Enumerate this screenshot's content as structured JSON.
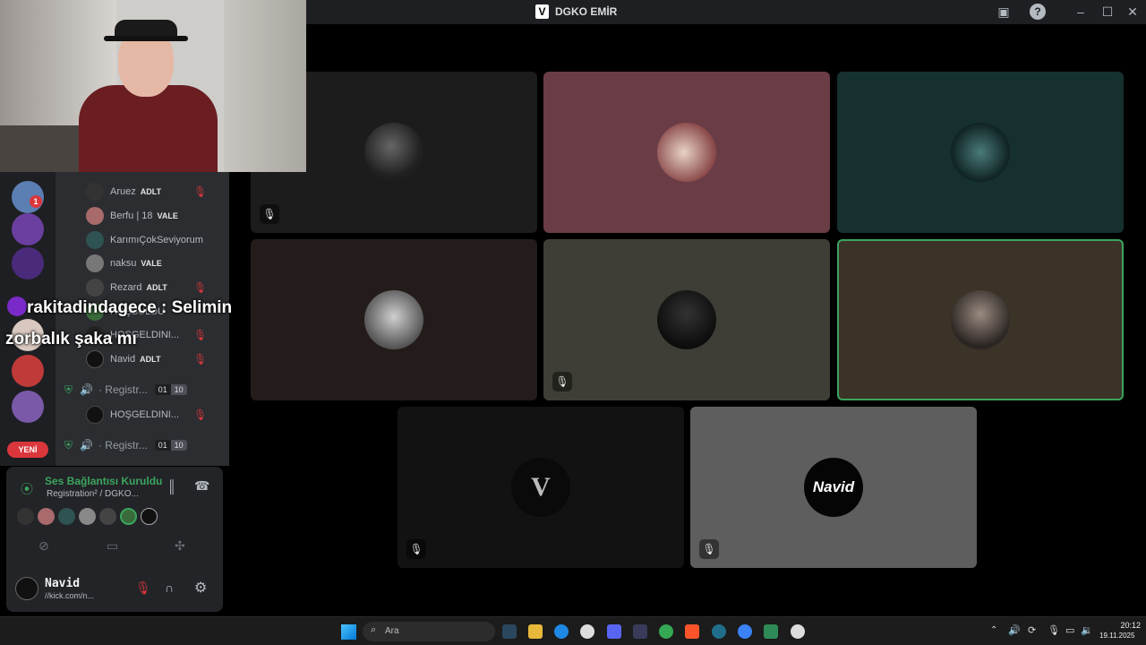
{
  "window": {
    "title": "DGKO EMİR",
    "logo_letter": "V"
  },
  "members": [
    {
      "name": "Aruez",
      "tag": "ADLT"
    },
    {
      "name": "Berfu | 18",
      "tag": "VALE"
    },
    {
      "name": "KarımıÇokSeviyorum",
      "tag": ""
    },
    {
      "name": "naksu",
      "tag": "VALE"
    },
    {
      "name": "Rezard",
      "tag": "ADLT"
    },
    {
      "name": "HOŞBULDU",
      "tag": ""
    },
    {
      "name": "HOŞGELDINI...",
      "tag": ""
    },
    {
      "name": "Navid",
      "tag": "ADLT"
    }
  ],
  "channels": [
    {
      "label": "· Registr...",
      "count_a": "01",
      "count_b": "10"
    },
    {
      "label": "· Registr...",
      "count_a": "01",
      "count_b": "10"
    }
  ],
  "channel_member_mid": "HOŞGELDINI...",
  "guilds": {
    "new_badge": "YENİ",
    "notif_count": "1"
  },
  "chat": {
    "user": "rakitadindagece",
    "separator": " : ",
    "message": "Selimin zorbalık şaka mı"
  },
  "voice": {
    "status": "Ses Bağlantısı Kuruldu",
    "channel": "Registration² / DGKO..."
  },
  "user": {
    "name": "Navid",
    "status": "//kick.com/n..."
  },
  "taskbar": {
    "search_placeholder": "Ara",
    "time": "20:12",
    "date": "19.11.2025"
  },
  "tiles": [
    {
      "color": "#1c1c1c",
      "muted": true
    },
    {
      "color": "#6a3c45",
      "muted": false
    },
    {
      "color": "#16302f",
      "muted": false
    },
    {
      "color": "#231c1a",
      "muted": false
    },
    {
      "color": "#3f3e36",
      "muted": true
    },
    {
      "color": "#3b3228",
      "muted": false,
      "speaking": true
    },
    {
      "color": "#121212",
      "muted": true
    },
    {
      "color": "#5e5e5e",
      "muted": true
    }
  ],
  "nameplate": "Navid"
}
